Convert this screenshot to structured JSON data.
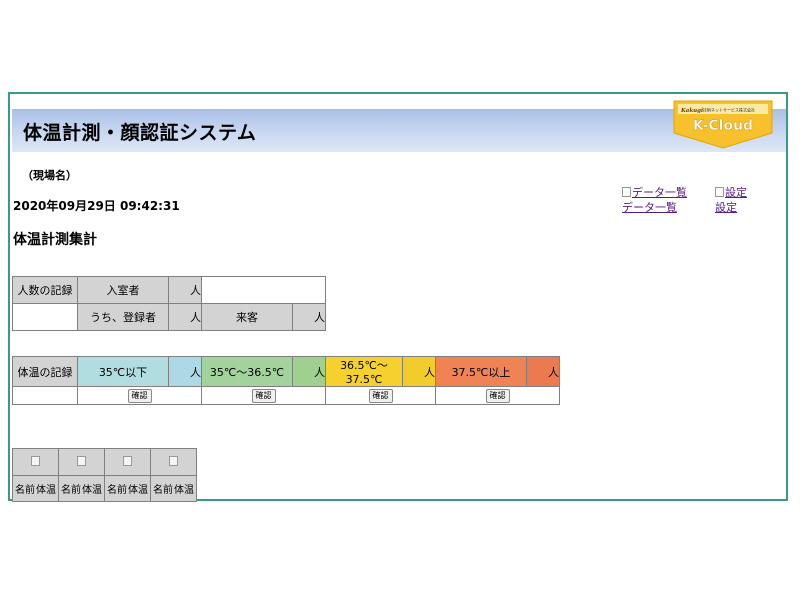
{
  "header": {
    "title": "体温計測・顔認証システム",
    "logo": {
      "company": "技術ネットサービス株式会社",
      "brand": "K-Cloud",
      "badge": "Kakugi"
    }
  },
  "site_name": "（現場名）",
  "datetime": "2020年09月29日 09:42:31",
  "section_title": "体温計測集計",
  "nav": {
    "data_list": {
      "alt": "データ一覧",
      "label": "データ一覧"
    },
    "settings": {
      "alt": "設定",
      "label": "設定"
    }
  },
  "count_table": {
    "header": "人数の記録",
    "entered_label": "入室者",
    "registered_label": "うち、登録者",
    "visitors_label": "来客",
    "unit": "人"
  },
  "temp_table": {
    "header": "体温の記録",
    "unit": "人",
    "confirm_label": "確認",
    "ranges": [
      {
        "label": "35℃以下",
        "color": "#b2dde0",
        "color_dark": "#add8e6"
      },
      {
        "label": "35℃～36.5℃",
        "color": "#a3d39c",
        "color_dark": "#a0d090"
      },
      {
        "label": "36.5℃～37.5℃",
        "color": "#f5d130",
        "color_dark": "#f2cc2a"
      },
      {
        "label": "37.5℃以上",
        "color": "#ef8354",
        "color_dark": "#ec7a50"
      }
    ]
  },
  "person_table": {
    "name_label": "名前",
    "temp_label": "体温",
    "columns": 4
  },
  "colors": {
    "frame": "#3a9a8a",
    "header_top": "#a8bfe6",
    "logo": "#f6c12c"
  }
}
